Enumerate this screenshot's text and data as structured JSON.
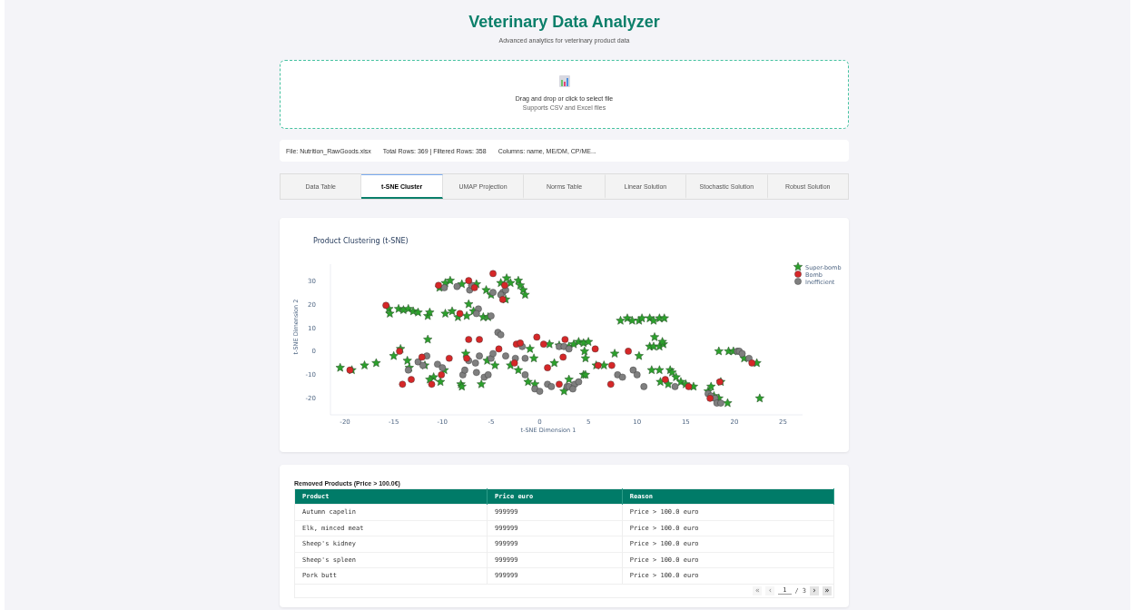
{
  "header": {
    "title": "Veterinary Data Analyzer",
    "subtitle": "Advanced analytics for veterinary product data"
  },
  "upload": {
    "prompt": "Drag and drop or click to select file",
    "hint": "Supports CSV and Excel files"
  },
  "file_info": [
    "File: Nutrition_RawGoods.xlsx",
    "Total Rows: 369 | Filtered Rows: 358",
    "Columns: name, ME/DM, CP/ME..."
  ],
  "tabs": [
    {
      "label": "Data Table",
      "selected": false
    },
    {
      "label": "t-SNE Cluster",
      "selected": true
    },
    {
      "label": "UMAP Projection",
      "selected": false
    },
    {
      "label": "Norms Table",
      "selected": false
    },
    {
      "label": "Linear Solution",
      "selected": false
    },
    {
      "label": "Stochastic Solution",
      "selected": false
    },
    {
      "label": "Robust Solution",
      "selected": false
    }
  ],
  "cluster_panel": {
    "chart_data": {
      "type": "scatter",
      "title": "Product Clustering (t-SNE)",
      "xlabel": "t-SNE Dimension 1",
      "ylabel": "t-SNE Dimension 2",
      "legend": true,
      "xlim": [
        -21.5,
        27
      ],
      "ylim": [
        -27,
        37
      ],
      "xticks": [
        -20,
        -15,
        -10,
        -5,
        0,
        5,
        10,
        15,
        20,
        25
      ],
      "yticks": [
        -20,
        -10,
        0,
        10,
        20,
        30
      ],
      "series": [
        {
          "name": "Super-bomb",
          "color": "#2ca02c",
          "marker": "star",
          "x": [
            -20.5,
            -19.3,
            -18,
            -16.8,
            -15.5,
            -15.4,
            -14.5,
            -14,
            -13.5,
            -13,
            -12.5,
            -11.5,
            -11.3,
            -9.7,
            -9,
            -8.4,
            -7.5,
            -7.3,
            -6.8,
            -5.8,
            -5.3,
            -10.3,
            -9.7,
            -9.2,
            -8,
            -6.5,
            -5.5,
            -5,
            -4,
            -3.4,
            -3,
            -2.2,
            -2,
            -1.7,
            -1.5,
            -3.5,
            -11.5,
            -14.3,
            -15,
            -13.6,
            -13.4,
            -11.8,
            -10.9,
            -11.3,
            -10.2,
            -9.8,
            -8.1,
            -8,
            -7.6,
            -6,
            -5.4,
            -4.6,
            -3,
            -2.2,
            -1,
            -0.6,
            -0.5,
            -1.2,
            1,
            1.5,
            2,
            3,
            3.5,
            4,
            4.5,
            4.6,
            4.7,
            5,
            2.5,
            4.5,
            4.7,
            3,
            5.8,
            6.6,
            7.7,
            8.3,
            9,
            9.5,
            10.2,
            10.5,
            11.3,
            11.7,
            12.3,
            12.8,
            11.8,
            11.3,
            11.7,
            12.3,
            12.7,
            12.6,
            10.2,
            11.5,
            12.3,
            13.4,
            13.6,
            14,
            14.5,
            15,
            15.8,
            12.4,
            13.2,
            17.3,
            17.6,
            17.9,
            18.4,
            18.6,
            19.3,
            22.6,
            18.4,
            19.4,
            19.9,
            21,
            22.3
          ],
          "values": [
            -7,
            -8,
            -6,
            -5,
            18,
            16,
            18,
            17.5,
            18,
            17,
            16.5,
            15,
            16.5,
            16,
            17,
            14.5,
            15,
            20,
            17,
            14.5,
            14.5,
            27,
            29,
            30,
            28.5,
            28.5,
            26,
            24,
            29,
            31,
            29,
            30,
            28,
            26,
            24,
            22,
            5,
            1,
            -2,
            -4,
            -7,
            -6,
            -11,
            -12,
            -13,
            -8,
            -14,
            -15,
            -1,
            -14,
            -4,
            -6,
            -6,
            -8,
            1,
            -3,
            -14,
            -13,
            3,
            -5,
            2.5,
            2,
            3,
            4,
            3.5,
            0,
            -3,
            4,
            -17,
            -10,
            -10,
            -12,
            -6,
            -6,
            -1,
            13,
            14,
            13,
            13,
            14,
            14,
            13,
            14,
            14,
            6,
            2,
            2,
            2,
            3,
            4,
            -2,
            -8,
            -8,
            -8,
            -9,
            -11,
            -13,
            -14,
            -15,
            -13,
            -14,
            -17,
            -15,
            -19,
            -20,
            -13,
            -22,
            -20,
            0,
            0,
            0,
            -3,
            -5
          ]
        },
        {
          "name": "Bomb",
          "color": "#d62728",
          "marker": "circle",
          "x": [
            -19.5,
            -15.8,
            -14.4,
            -14.1,
            -13.2,
            -12.1,
            -11.1,
            -10.4,
            -10.1,
            -9.3,
            -8.2,
            -7.3,
            -7.3,
            -7.5,
            -6.2,
            -6.7,
            -4.8,
            -3.6,
            -3.8,
            -4.2,
            -2.4,
            -2,
            -2.6,
            -0.3,
            0.4,
            0.8,
            2.4,
            2.6,
            2,
            6,
            5.7,
            7.4,
            7.3,
            9.1,
            12.9,
            15.3,
            17.5,
            18.5,
            21.8
          ],
          "values": [
            -8,
            19.5,
            0,
            -14,
            -12,
            -2.5,
            -14,
            28,
            -10,
            -3,
            16,
            30,
            5,
            -3,
            5,
            27,
            33,
            28,
            22,
            1,
            3,
            3.5,
            -5,
            6,
            3,
            -7,
            -2.5,
            5,
            -14,
            -6,
            1,
            -6,
            -14,
            0,
            -12,
            -15,
            -20,
            -13,
            -5
          ]
        },
        {
          "name": "Inefficient",
          "color": "#7f7f7f",
          "marker": "circle",
          "x": [
            -13.5,
            -12.5,
            -12,
            -11.6,
            -10.5,
            -10,
            -9.8,
            -8.5,
            -7.9,
            -7.7,
            -7.3,
            -7.2,
            -7,
            -6.6,
            -6.5,
            -5.7,
            -5.3,
            -6.2,
            -5,
            -5,
            -6.3,
            -6.5,
            -4.8,
            -4.3,
            -4,
            -3.5,
            -3.8,
            -4,
            -3.5,
            -4.8,
            -2.5,
            -1.8,
            -1.5,
            -1.5,
            -0.5,
            0,
            0.8,
            1.2,
            2.8,
            3,
            3.6,
            3.4,
            4,
            2,
            2.5,
            3,
            8,
            8.5,
            9.6,
            10,
            10.7,
            13.9,
            17.3,
            17.6,
            18,
            18.2,
            18.6,
            20.3,
            20.5,
            20.8,
            21.5
          ],
          "values": [
            -8,
            -4.5,
            -6,
            -2,
            -5.5,
            -7,
            27,
            27.5,
            -10,
            -8,
            -4,
            26,
            28,
            -5,
            -9,
            -11,
            -10,
            -2,
            -3,
            15,
            18,
            16,
            -1,
            8,
            7,
            -2,
            25,
            24,
            26,
            25,
            -3,
            2,
            -3,
            -10,
            -16,
            -17,
            -14,
            -15,
            -15,
            -15,
            -14,
            -16,
            -13,
            2,
            2,
            1,
            -10,
            -11,
            -8,
            -10,
            -15,
            -15,
            -18,
            -19,
            -20,
            -22,
            -22,
            0,
            0,
            -1,
            -3
          ]
        }
      ]
    }
  },
  "removed_products": {
    "title": "Removed Products (Price > 100.0€)",
    "columns": [
      "Product",
      "Price euro",
      "Reason"
    ],
    "rows": [
      [
        "Autumn capelin",
        "999999",
        "Price > 100.0 euro"
      ],
      [
        "Elk, minced meat",
        "999999",
        "Price > 100.0 euro"
      ],
      [
        "Sheep's kidney",
        "999999",
        "Price > 100.0 euro"
      ],
      [
        "Sheep's spleen",
        "999999",
        "Price > 100.0 euro"
      ],
      [
        "Pork butt",
        "999999",
        "Price > 100.0 euro"
      ]
    ],
    "pagination": {
      "first": {
        "label": "«",
        "disabled": true
      },
      "prev": {
        "label": "‹",
        "disabled": true
      },
      "page": "1",
      "separator": "/",
      "total": "3",
      "next": {
        "label": "›",
        "disabled": false
      },
      "last": {
        "label": "»",
        "disabled": false
      }
    }
  }
}
